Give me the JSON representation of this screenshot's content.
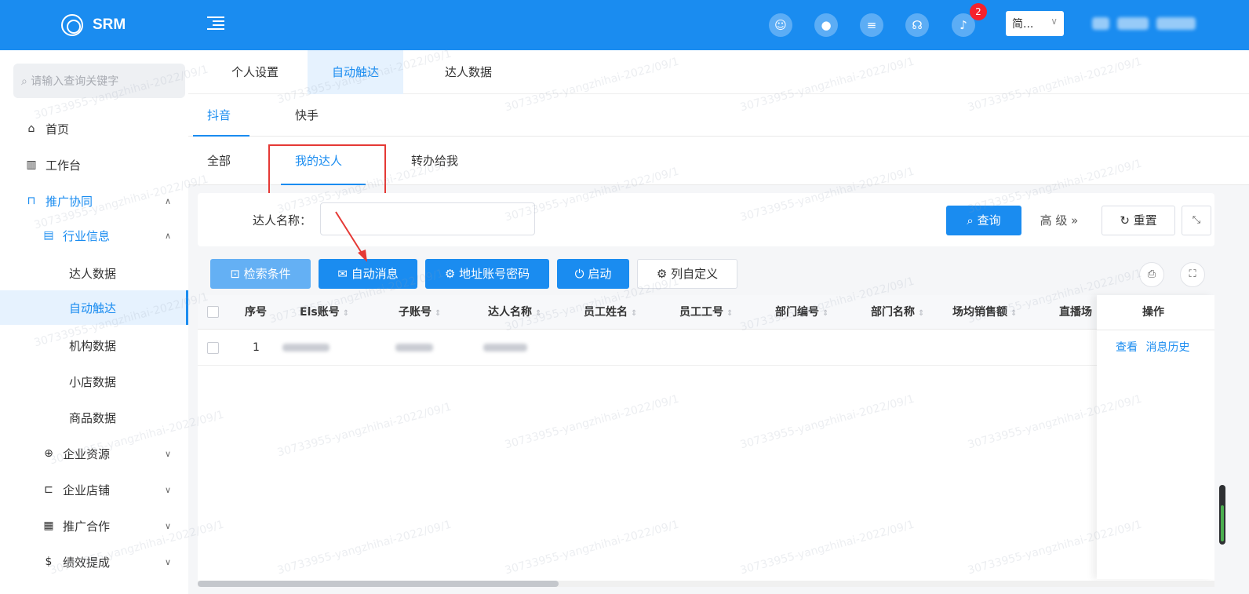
{
  "app": {
    "name": "SRM"
  },
  "header": {
    "notification_count": "2",
    "language": "简...",
    "icons": [
      "user-pin-icon",
      "circle-icon",
      "message-icon",
      "support-icon",
      "bell-icon"
    ]
  },
  "sidebar": {
    "search_placeholder": "请输入查询关键字",
    "items": [
      {
        "label": "首页",
        "icon": "home-icon",
        "level": 0
      },
      {
        "label": "工作台",
        "icon": "chart-icon",
        "level": 0
      },
      {
        "label": "推广协同",
        "icon": "bag-icon",
        "level": 0
      },
      {
        "label": "行业信息",
        "icon": "list-icon",
        "level": 1
      },
      {
        "label": "达人数据",
        "level": 2
      },
      {
        "label": "自动触达",
        "level": 2
      },
      {
        "label": "机构数据",
        "level": 2
      },
      {
        "label": "小店数据",
        "level": 2
      },
      {
        "label": "商品数据",
        "level": 2
      },
      {
        "label": "企业资源",
        "icon": "globe-icon",
        "level": 1
      },
      {
        "label": "企业店铺",
        "icon": "shop-icon",
        "level": 1
      },
      {
        "label": "推广合作",
        "icon": "doc-icon",
        "level": 1
      },
      {
        "label": "绩效提成",
        "icon": "dollar-icon",
        "level": 1
      }
    ]
  },
  "tabs_top": [
    "个人设置",
    "自动触达",
    "达人数据"
  ],
  "tabs_platform": [
    "抖音",
    "快手"
  ],
  "tabs_scope": [
    "全部",
    "我的达人",
    "转办给我"
  ],
  "filter": {
    "label": "达人名称：",
    "query": "查询",
    "advanced": "高 级 »",
    "reset": "重置"
  },
  "toolbar": [
    "检索条件",
    "自动消息",
    "地址账号密码",
    "启动",
    "列自定义"
  ],
  "table": {
    "columns": [
      "序号",
      "Els账号",
      "子账号",
      "达人名称",
      "员工姓名",
      "员工工号",
      "部门编号",
      "部门名称",
      "场均销售额",
      "直播场"
    ],
    "action_header": "操作",
    "rows": [
      {
        "index": "1",
        "actions": [
          "查看",
          "消息历史"
        ]
      }
    ]
  },
  "watermark": "30733955-yangzhihai-2022/09/1"
}
